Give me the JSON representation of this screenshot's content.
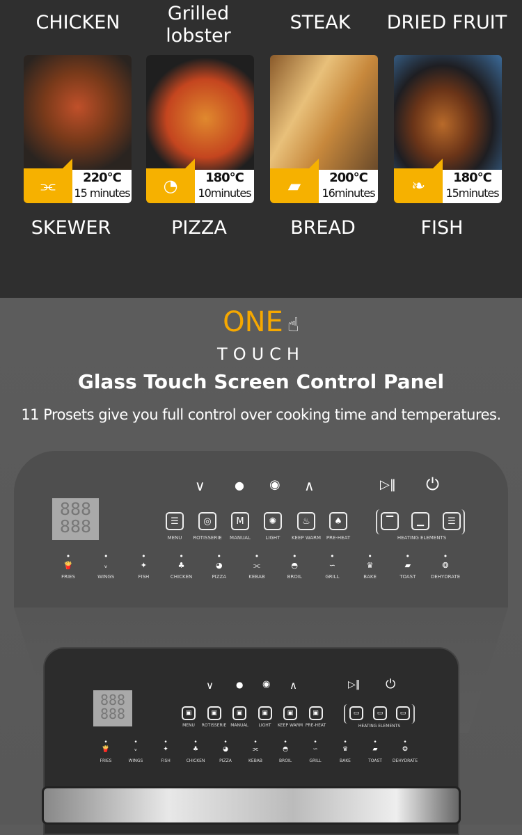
{
  "presets_top": [
    "CHICKEN",
    "Grilled lobster",
    "STEAK",
    "DRIED FRUIT"
  ],
  "cards": [
    {
      "label": "SKEWER",
      "temp": "220°C",
      "time": "15 minutes",
      "icon": "skewer-icon"
    },
    {
      "label": "PIZZA",
      "temp": "180°C",
      "time": "10minutes",
      "icon": "pizza-icon"
    },
    {
      "label": "BREAD",
      "temp": "200°C",
      "time": "16minutes",
      "icon": "bread-icon"
    },
    {
      "label": "FISH",
      "temp": "180°C",
      "time": "15minutes",
      "icon": "fish-icon"
    }
  ],
  "hero": {
    "one": "ONE",
    "touch": "TOUCH",
    "title": "Glass Touch Screen Control Panel",
    "subtitle": "11 Prosets give you full control over cooking time and temperatures."
  },
  "panel": {
    "lcd": "888",
    "top_controls": [
      "down-icon",
      "fan-icon",
      "rotate-icon",
      "up-icon",
      "play-pause-icon",
      "power-icon"
    ],
    "functions": [
      "MENU",
      "ROTISSERIE",
      "MANUAL",
      "LIGHT",
      "KEEP WARM",
      "PRE-HEAT"
    ],
    "heating_label": "HEATING ELEMENTS",
    "presets": [
      "FRIES",
      "WINGS",
      "FISH",
      "CHICKEN",
      "PIZZA",
      "KEBAB",
      "BROIL",
      "GRILL",
      "BAKE",
      "TOAST",
      "DEHYDRATE"
    ]
  },
  "colors": {
    "accent": "#f6b100",
    "dark_bg": "#2f2f2f",
    "panel": "#4e4e4e"
  }
}
